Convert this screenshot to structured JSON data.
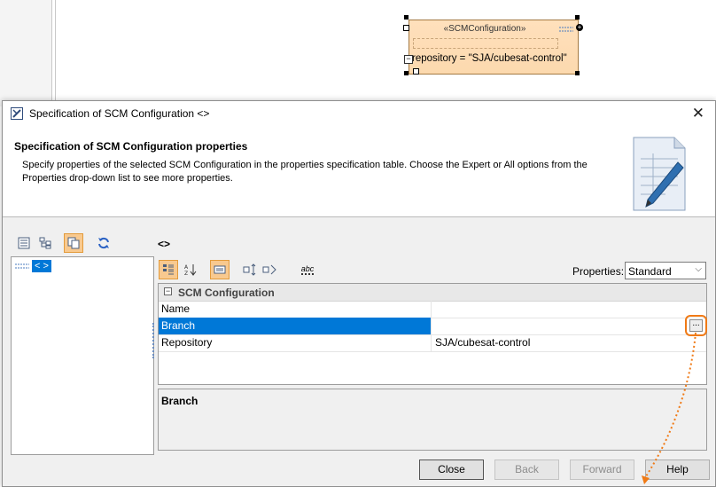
{
  "diagram": {
    "shape_stereotype": "«SCMConfiguration»",
    "shape_attribute": "repository = \"SJA/cubesat-control\""
  },
  "dialog": {
    "title": "Specification of SCM Configuration <>",
    "header_title": "Specification of SCM Configuration properties",
    "header_desc": "Specify properties of the selected SCM Configuration in the properties specification table. Choose the Expert or All options from the Properties drop-down list to see more properties.",
    "tree_selected": "< >",
    "path_label": "<>",
    "properties_label": "Properties:",
    "properties_value": "Standard",
    "toolbar_abc": "abc",
    "grid": {
      "group": "SCM Configuration",
      "rows": [
        {
          "name": "Name",
          "value": ""
        },
        {
          "name": "Branch",
          "value": ""
        },
        {
          "name": "Repository",
          "value": "SJA/cubesat-control"
        }
      ],
      "ellipsis": "..."
    },
    "description_title": "Branch",
    "buttons": {
      "close": "Close",
      "back": "Back",
      "forward": "Forward",
      "help": "Help"
    }
  },
  "colors": {
    "selection": "#0078d7",
    "highlight": "#f07a16",
    "shape_fill": "#fcd9ae"
  }
}
